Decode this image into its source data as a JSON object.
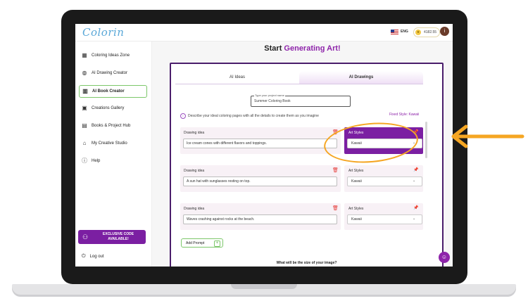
{
  "header": {
    "logo": "Colorin",
    "language": "ENG",
    "credits": "4182.55",
    "avatar_initial": "i"
  },
  "sidebar": {
    "items": [
      {
        "label": "Coloring Ideas Zone",
        "icon": "grid-icon"
      },
      {
        "label": "AI Drawing Creator",
        "icon": "palette-icon"
      },
      {
        "label": "AI Book Creator",
        "icon": "book-icon",
        "active": true
      },
      {
        "label": "Creations Gallery",
        "icon": "gallery-icon"
      },
      {
        "label": "Books & Project Hub",
        "icon": "folder-icon"
      },
      {
        "label": "My Creative Studio",
        "icon": "studio-icon"
      },
      {
        "label": "Help",
        "icon": "help-icon"
      }
    ],
    "promo": "EXCLUSIVE CODE AVAILABLE!",
    "logout": "Log out"
  },
  "main": {
    "title_prefix": "Start",
    "title_accent": "Generating Art!",
    "tabs": [
      "AI Ideas",
      "AI Drawings"
    ],
    "project": {
      "label": "Type your project name",
      "value": "Summer Coloring Book"
    },
    "describe": "Describe your ideal coloring pages with all the details to create them as you imagine",
    "fixed_style": "Fixed Style: Kawaii",
    "drawing_label": "Drawing idea",
    "styles_label": "Art Styles",
    "ideas": [
      {
        "text": "Ice cream cones with different flavors and toppings.",
        "style": "Kawaii"
      },
      {
        "text": "A sun hat with sunglasses resting on top.",
        "style": "Kawaii"
      },
      {
        "text": "Waves crashing against rocks at the beach.",
        "style": "Kawaii"
      }
    ],
    "add_prompt": "Add Prompt",
    "size_question": "What will be the size of your image?"
  },
  "colors": {
    "accent": "#7b1fa2",
    "highlight": "#f5a623",
    "green": "#7cc76a"
  }
}
